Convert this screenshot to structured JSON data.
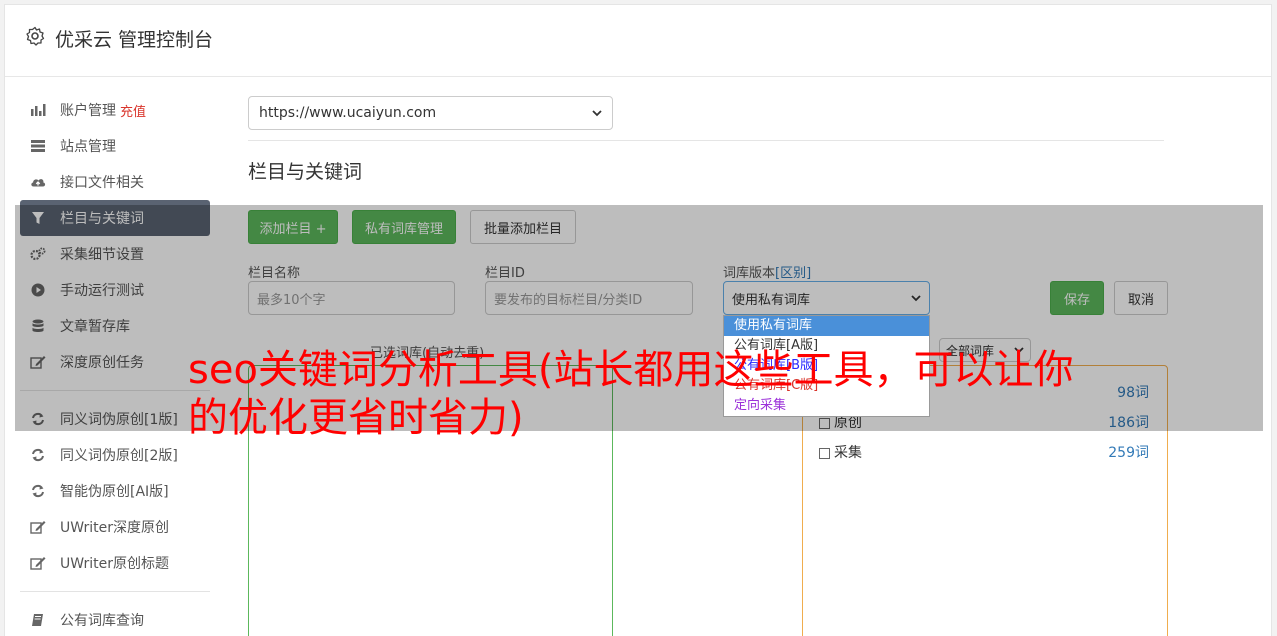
{
  "app": {
    "title": "优采云 管理控制台"
  },
  "sidebar": {
    "items": [
      {
        "label": "账户管理",
        "extra": "充值",
        "icon": "bar-chart-icon"
      },
      {
        "label": "站点管理",
        "icon": "server-icon"
      },
      {
        "label": "接口文件相关",
        "icon": "cloud-upload-icon"
      },
      {
        "label": "栏目与关键词",
        "icon": "filter-icon",
        "active": true
      },
      {
        "label": "采集细节设置",
        "icon": "cogs-icon"
      },
      {
        "label": "手动运行测试",
        "icon": "play-circle-icon"
      },
      {
        "label": "文章暂存库",
        "icon": "database-icon"
      },
      {
        "label": "深度原创任务",
        "icon": "edit-icon"
      }
    ],
    "group2": [
      {
        "label": "同义词伪原创[1版]",
        "icon": "refresh-icon"
      },
      {
        "label": "同义词伪原创[2版]",
        "icon": "refresh-icon"
      },
      {
        "label": "智能伪原创[AI版]",
        "icon": "refresh-icon"
      },
      {
        "label": "UWriter深度原创",
        "icon": "edit-icon"
      },
      {
        "label": "UWriter原创标题",
        "icon": "edit-icon"
      }
    ],
    "group3": [
      {
        "label": "公有词库查询",
        "icon": "book-icon"
      }
    ]
  },
  "main": {
    "site_select": "https://www.ucaiyun.com",
    "section_title": "栏目与关键词",
    "buttons": {
      "add_column": "添加栏目 +",
      "private_lib": "私有词库管理",
      "batch_add": "批量添加栏目",
      "save": "保存",
      "cancel": "取消"
    },
    "form": {
      "name_label": "栏目名称",
      "name_placeholder": "最多10个字",
      "id_label": "栏目ID",
      "id_placeholder": "要发布的目标栏目/分类ID",
      "lib_label": "词库版本",
      "lib_label_link": "[区别]",
      "lib_value": "使用私有词库",
      "lib_options": [
        "使用私有词库",
        "公有词库[A版]",
        "公有词库[B版]",
        "公有词库[C版]",
        "定向采集"
      ]
    },
    "left_panel_caption": "已选词库(自动去重)",
    "filter_select": "全部词库",
    "libraries": [
      {
        "name": "",
        "count": "98词"
      },
      {
        "name": "原创",
        "count": "186词"
      },
      {
        "name": "采集",
        "count": "259词"
      }
    ]
  },
  "banner": {
    "text": "seo关键词分析工具(站长都用这些工具，可以让你的优化更省时省力)"
  },
  "colors": {
    "green": "#5cb85c",
    "orange": "#f0ad4e",
    "banner_red": "#ff0000",
    "active_sidebar": "#5a6372"
  }
}
